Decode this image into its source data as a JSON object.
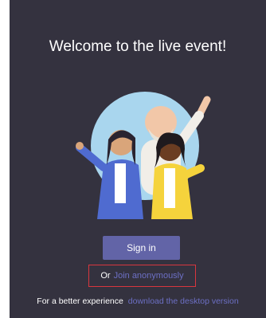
{
  "welcome": {
    "title": "Welcome to the live event!"
  },
  "illustration": {
    "icon": "people-waving-illustration",
    "circle_color": "#a9d6ee"
  },
  "actions": {
    "sign_in_label": "Sign in",
    "or_text": "Or",
    "join_anonymously_label": "Join anonymously"
  },
  "footer": {
    "prefix": "For a better experience",
    "download_link": "download the desktop version"
  },
  "colors": {
    "background": "#34323f",
    "accent": "#6264a7",
    "link": "#6c6fc4",
    "highlight_border": "#d9363e"
  }
}
